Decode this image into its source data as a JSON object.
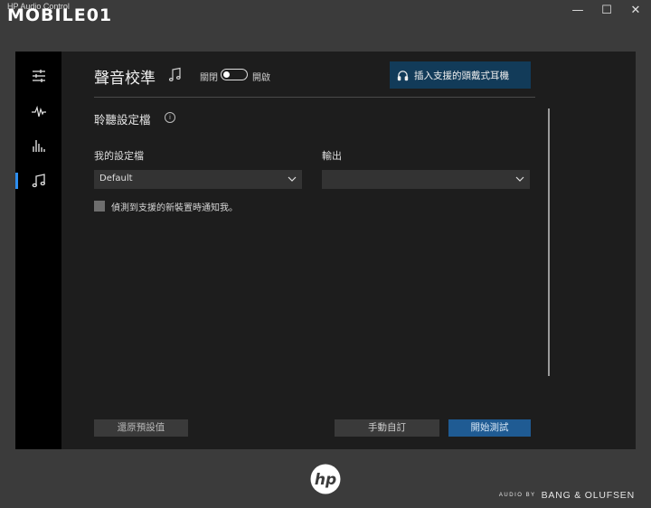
{
  "window": {
    "title": "HP Audio Control",
    "watermark": "MOBILE01",
    "controls": {
      "minimize": "—",
      "maximize": "☐",
      "close": "✕"
    }
  },
  "sidebar": {
    "items": [
      {
        "icon": "sliders-icon"
      },
      {
        "icon": "waveform-icon"
      },
      {
        "icon": "equalizer-icon"
      },
      {
        "icon": "music-note-icon",
        "active": true
      }
    ]
  },
  "header": {
    "title": "聲音校準",
    "toggle_off_label": "關閉",
    "toggle_on_label": "開啟",
    "toggle_state": false,
    "notice": "插入支援的頭戴式耳機"
  },
  "section": {
    "title": "聆聽設定檔",
    "profile_label": "我的設定檔",
    "profile_value": "Default",
    "output_label": "輸出",
    "output_value": "",
    "notify_label": "偵測到支援的新裝置時通知我。",
    "notify_checked": false
  },
  "buttons": {
    "reset": "還原預設值",
    "manual": "手動自訂",
    "start": "開始測試"
  },
  "footer": {
    "logo": "hp",
    "audio_by": "AUDIO BY",
    "brand": "BANG & OLUFSEN"
  },
  "colors": {
    "accent": "#2d8ef0",
    "notice_bg": "#123b59",
    "start_button": "#1f5b93"
  }
}
